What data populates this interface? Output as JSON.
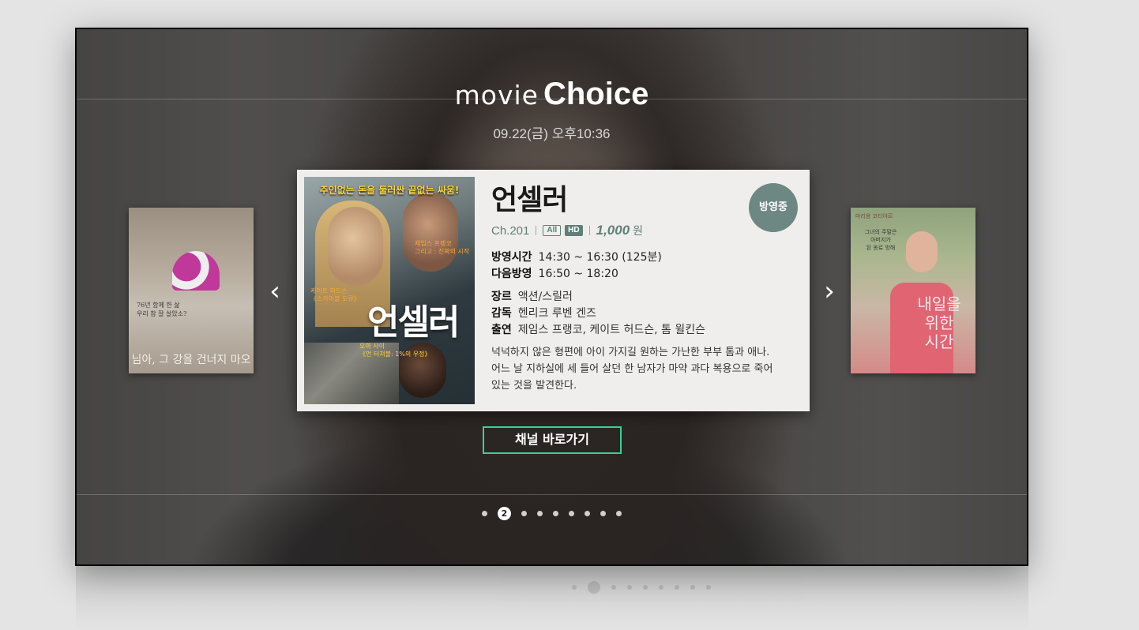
{
  "header": {
    "logo_movie": "movie",
    "logo_choice": "Choice",
    "datetime": "09.22(금) 오후10:36"
  },
  "posters": {
    "left": {
      "caption": "님아, 그 강을 건너지 마오",
      "small_text": "76년 함께 한 삶\n우리 참 잘 살았소?"
    },
    "right": {
      "title_line1": "내일을",
      "title_line2": "위한",
      "title_line3": "시간",
      "small_text": "그녀의 주말은\n아버지가\n된 동료 방해",
      "topline": "마리옹 코티야르"
    }
  },
  "featured": {
    "poster": {
      "tagline": "주인없는 돈을 둘러싼 끝없는 싸움!",
      "title_art": "언셀러",
      "small_orange": "케이트 허드슨\n《스카이블 도큐》",
      "small_orange2": "제임스 프랭코\n그리고 : 진짜의 시작",
      "small_yellow": "오마 사이\n《언 터쳐블: 1%의 우정》"
    },
    "title": "언셀러",
    "channel": "Ch.201",
    "rating": "All",
    "quality": "HD",
    "price": "1,000",
    "currency": "원",
    "status": "방영중",
    "airtime_label": "방영시간",
    "airtime_value": "14:30 ~ 16:30 (125분)",
    "next_label": "다음방영",
    "next_value": "16:50 ~ 18:20",
    "genre_label": "장르",
    "genre_value": "액션/스릴러",
    "director_label": "감독",
    "director_value": "헨리크 루벤 겐즈",
    "cast_label": "출연",
    "cast_value": "제임스 프랭코, 케이트 허드슨, 톰 윌킨슨",
    "synopsis": "넉넉하지 않은 형편에 아이 가지길 원하는 가난한 부부 톰과 애나. 어느 날 지하실에 세 들어 살던 한 남자가 마약 과다 복용으로 죽어있는 것을 발견한다."
  },
  "actions": {
    "channel_button": "채널 바로가기"
  },
  "pager": {
    "total": 9,
    "current": 2,
    "current_label": "2"
  },
  "colors": {
    "accent_green": "#37d293",
    "meta_teal": "#5e8079",
    "status_badge": "#6d8883"
  }
}
